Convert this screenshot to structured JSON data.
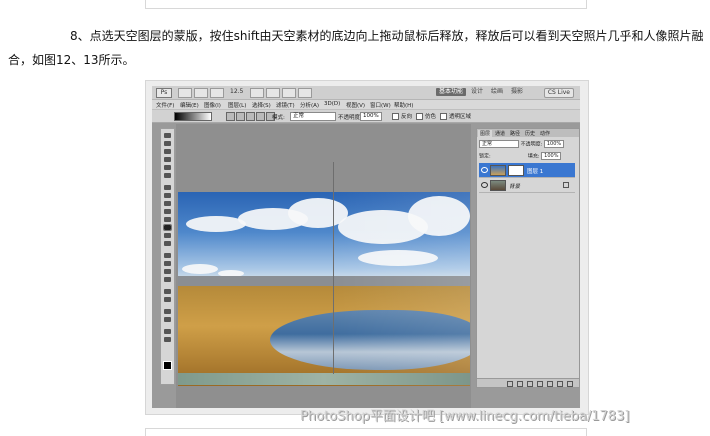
{
  "article": {
    "step_text": "8、点选天空图层的蒙版，按住shift由天空素材的底边向上拖动鼠标后释放，释放后可以看到天空照片几乎和人像照片融合，如图12、13所示。"
  },
  "photoshop": {
    "logo": "Ps",
    "zoom": "12.5",
    "workspace_buttons": [
      "基本功能",
      "设计",
      "绘画",
      "摄影"
    ],
    "cs_live": "CS Live",
    "menu": [
      "文件(F)",
      "编辑(E)",
      "图像(I)",
      "图层(L)",
      "选择(S)",
      "滤镜(T)",
      "分析(A)",
      "3D(D)",
      "视图(V)",
      "窗口(W)",
      "帮助(H)"
    ],
    "options": {
      "mode_label": "模式:",
      "mode_value": "正常",
      "opacity_label": "不透明度:",
      "opacity_value": "100%",
      "reverse": "反向",
      "dither": "仿色",
      "transparency": "透明区域"
    },
    "panel": {
      "tabs": [
        "图层",
        "通道",
        "路径",
        "历史",
        "动作"
      ],
      "blend_mode": "正常",
      "opacity_label": "不透明度:",
      "opacity_value": "100%",
      "lock_label": "锁定:",
      "fill_label": "填充:",
      "fill_value": "100%",
      "layers": [
        {
          "name": "图层 1",
          "selected": true
        },
        {
          "name": "背景",
          "selected": false
        }
      ]
    }
  },
  "watermark": "PhotoShop平面设计吧 [www.linecg.com/tieba/1783]"
}
